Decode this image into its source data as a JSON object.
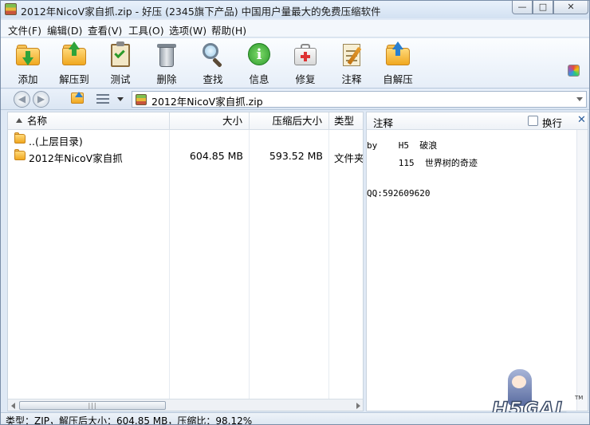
{
  "window": {
    "title": "2012年NicoV家自抓.zip - 好压 (2345旗下产品) 中国用户量最大的免费压缩软件",
    "controls": [
      "minimize",
      "maximize",
      "close"
    ]
  },
  "menu": [
    {
      "label": "文件(F)"
    },
    {
      "label": "编辑(D)"
    },
    {
      "label": "查看(V)"
    },
    {
      "label": "工具(O)"
    },
    {
      "label": "选项(W)"
    },
    {
      "label": "帮助(H)"
    }
  ],
  "toolbar": {
    "items": [
      {
        "label": "添加",
        "icon": "add-folder-icon"
      },
      {
        "label": "解压到",
        "icon": "extract-folder-icon"
      },
      {
        "label": "测试",
        "icon": "test-clipboard-icon"
      },
      {
        "label": "删除",
        "icon": "trash-icon"
      },
      {
        "label": "查找",
        "icon": "magnifier-icon"
      },
      {
        "label": "信息",
        "icon": "info-icon"
      },
      {
        "label": "修复",
        "icon": "repair-kit-icon"
      },
      {
        "label": "注释",
        "icon": "comment-note-icon"
      },
      {
        "label": "自解压",
        "icon": "self-extract-icon"
      }
    ]
  },
  "address": {
    "path": "2012年NicoV家自抓.zip"
  },
  "filelist": {
    "columns": {
      "name": "名称",
      "size": "大小",
      "packed": "压缩后大小",
      "type": "类型"
    },
    "rows": [
      {
        "name": "..(上层目录)",
        "size": "",
        "packed": "",
        "type": ""
      },
      {
        "name": "2012年NicoV家自抓",
        "size": "604.85 MB",
        "packed": "593.52 MB",
        "type": "文件夹"
      }
    ]
  },
  "comment": {
    "title": "注释",
    "wrap_label": "换行",
    "wrap_checked": false,
    "lines": [
      "by    H5  破浪",
      "      115  世界树的奇迹",
      "",
      "QQ:592609620"
    ]
  },
  "watermark": {
    "logo_text": "H5GAL",
    "tm": "TM"
  },
  "status": {
    "text": "类型：ZIP，解压后大小：604.85 MB，压缩比：98.12%"
  },
  "colors": {
    "window_bg": "#dfe9f5",
    "toolbar_bg": "#e6eef8",
    "folder": "#f0a820",
    "accent": "#2fa33a"
  }
}
